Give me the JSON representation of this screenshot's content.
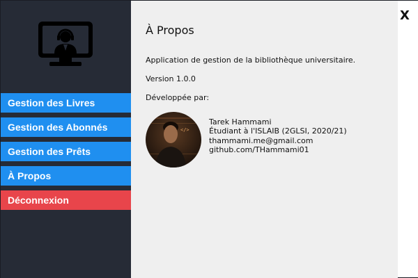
{
  "sidebar": {
    "logo_icon": "support-agent-monitor-icon",
    "items": [
      {
        "label": "Gestion des Livres",
        "color": "#1f8ff0"
      },
      {
        "label": "Gestion des Abonnés",
        "color": "#1f8ff0"
      },
      {
        "label": "Gestion des Prêts",
        "color": "#1f8ff0"
      },
      {
        "label": "À Propos",
        "color": "#1f8ff0"
      },
      {
        "label": "Déconnexion",
        "color": "#e8454b"
      }
    ]
  },
  "window": {
    "close_label": "X"
  },
  "about": {
    "title": "À Propos",
    "description": "Application de gestion de la bibliothèque universitaire.",
    "version": "Version 1.0.0",
    "developed_by": "Développée par:",
    "developer": {
      "name": "Tarek Hammami",
      "role": "Étudiant à l'ISLAIB (2GLSI, 2020/21)",
      "email": "thammami.me@gmail.com",
      "github": "github.com/THammami01"
    }
  },
  "colors": {
    "sidebar_bg": "#262b36",
    "nav_blue": "#1f8ff0",
    "nav_red": "#e8454b",
    "content_bg": "#efefef"
  }
}
